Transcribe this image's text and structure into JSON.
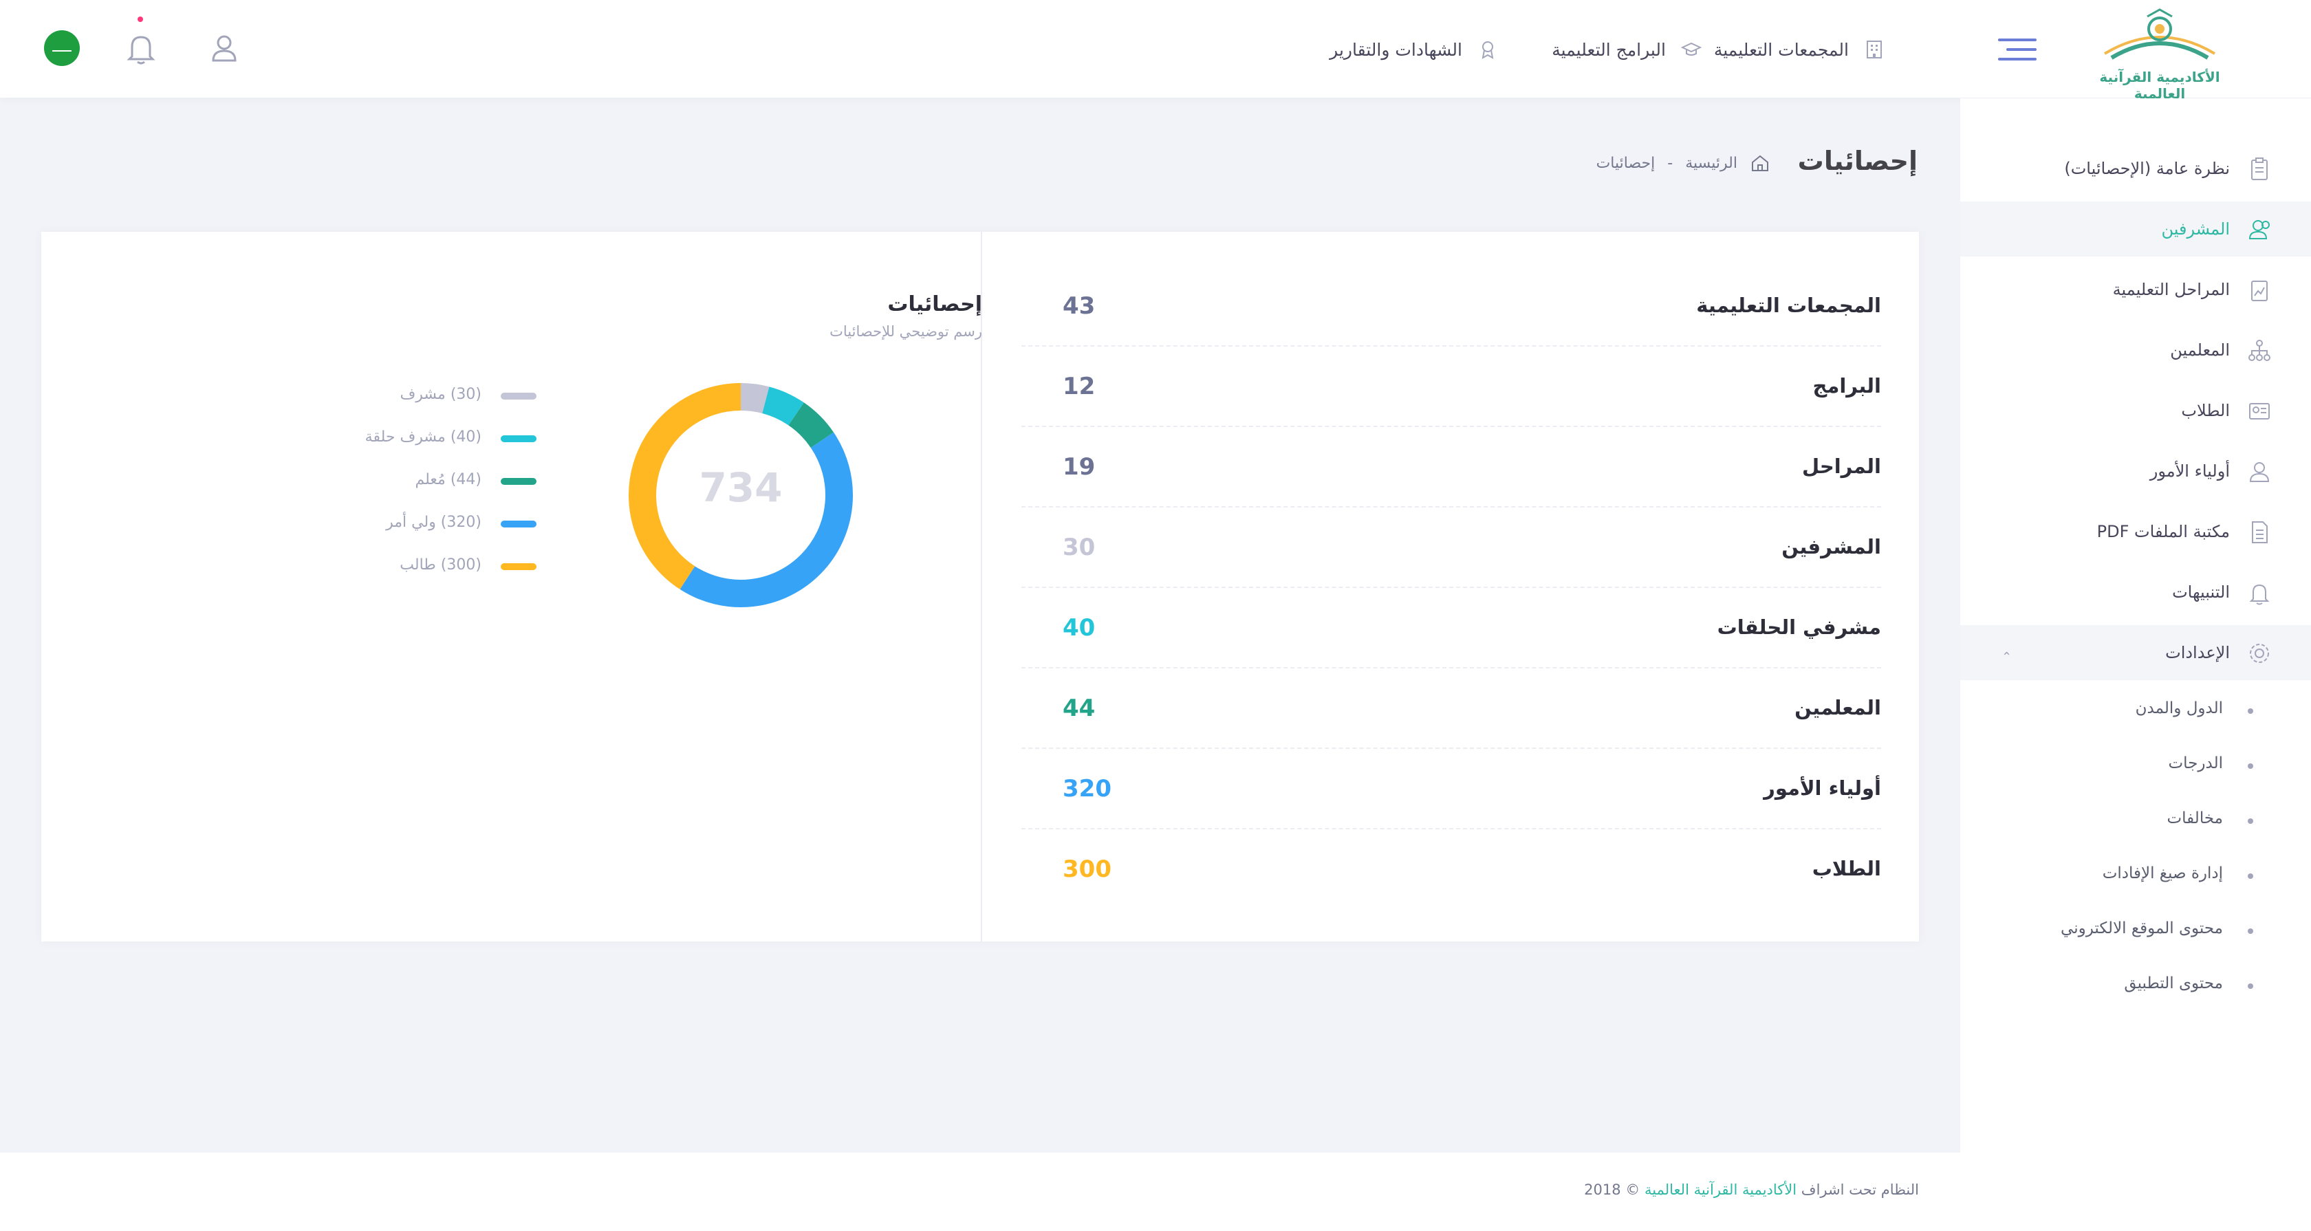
{
  "header": {
    "logo_text": "الأكاديمية القرآنية العالمية",
    "nav": [
      {
        "label": "المجمعات التعليمية",
        "icon": "building-icon"
      },
      {
        "label": "البرامج التعليمية",
        "icon": "graduation-cap-icon"
      },
      {
        "label": "الشهادات والتقارير",
        "icon": "award-icon"
      }
    ],
    "icons": [
      "user-icon",
      "bell-icon",
      "saudi-flag-icon"
    ]
  },
  "sidebar": {
    "items": [
      {
        "label": "نظرة عامة (الإحصائيات)",
        "icon": "clipboard-icon",
        "active": false
      },
      {
        "label": "المشرفين",
        "icon": "supervisors-icon",
        "active": true
      },
      {
        "label": "المراحل التعليمية",
        "icon": "chart-clipboard-icon",
        "active": false
      },
      {
        "label": "المعلمين",
        "icon": "hierarchy-icon",
        "active": false
      },
      {
        "label": "الطلاب",
        "icon": "students-icon",
        "active": false
      },
      {
        "label": "أولياء الأمور",
        "icon": "parent-icon",
        "active": false
      },
      {
        "label": "مكتبة الملفات PDF",
        "icon": "document-icon",
        "active": false
      },
      {
        "label": "التنبيهات",
        "icon": "bell-icon",
        "active": false
      },
      {
        "label": "الإعدادات",
        "icon": "gear-icon",
        "active": false
      }
    ],
    "settings_subitems": [
      "الدول والمدن",
      "الدرجات",
      "مخالفات",
      "إدارة صيغ الإفادات",
      "محتوى الموقع الالكتروني",
      "محتوى التطبيق"
    ]
  },
  "page": {
    "title": "إحصائيات",
    "breadcrumb": {
      "home": "الرئيسية",
      "separator": "-",
      "current": "إحصائيات"
    }
  },
  "stats": [
    {
      "label": "المجمعات التعليمية",
      "value": "43",
      "color": "#6c7293"
    },
    {
      "label": "البرامج",
      "value": "12",
      "color": "#6c7293"
    },
    {
      "label": "المراحل",
      "value": "19",
      "color": "#6c7293"
    },
    {
      "label": "المشرفين",
      "value": "30",
      "color": "#c4c5d6"
    },
    {
      "label": "مشرفي الحلقات",
      "value": "40",
      "color": "#23c6d9"
    },
    {
      "label": "المعلمين",
      "value": "44",
      "color": "#21a489"
    },
    {
      "label": "أولياء الأمور",
      "value": "320",
      "color": "#36a3f7"
    },
    {
      "label": "الطلاب",
      "value": "300",
      "color": "#ffb822"
    }
  ],
  "chart": {
    "title": "إحصائيات",
    "subtitle": "رسم توضيحي للإحصائيات",
    "total": "734"
  },
  "chart_data": {
    "type": "pie",
    "categories": [
      "مشرف",
      "مشرف حلقة",
      "مُعلم",
      "ولي أمر",
      "طالب"
    ],
    "values": [
      30,
      40,
      44,
      320,
      300
    ],
    "colors": [
      "#c4c5d6",
      "#23c6d9",
      "#21a489",
      "#36a3f7",
      "#ffb822"
    ],
    "legend_labels": [
      "(30) مشرف",
      "(40) مشرف حلقة",
      "(44) مُعلم",
      "(320) ولي أمر",
      "(300) طالب"
    ],
    "center_label": "734",
    "donut": true
  },
  "footer": {
    "prefix": "النظام تحت اشراف",
    "brand": "الأكاديمية القرآنية العالمية",
    "suffix": "© 2018"
  }
}
